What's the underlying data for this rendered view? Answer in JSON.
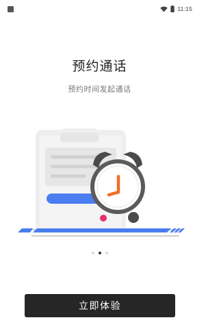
{
  "status_bar": {
    "time": "11:15",
    "icons": [
      "notification-icon",
      "wifi-icon",
      "battery-icon"
    ]
  },
  "onboarding": {
    "title": "预约通话",
    "subtitle": "预约时间发起通话",
    "illustration": "phone-with-alarm-clock",
    "page_count": 3,
    "active_page": 2
  },
  "cta": {
    "label": "立即体验"
  },
  "colors": {
    "accent_blue": "#4a7df0",
    "clock_hand_orange": "#f36b25",
    "pink_dot": "#e8306c",
    "button_dark": "#262626",
    "phone_gray": "#eeeeee",
    "clock_gray": "#5b5b5b"
  }
}
